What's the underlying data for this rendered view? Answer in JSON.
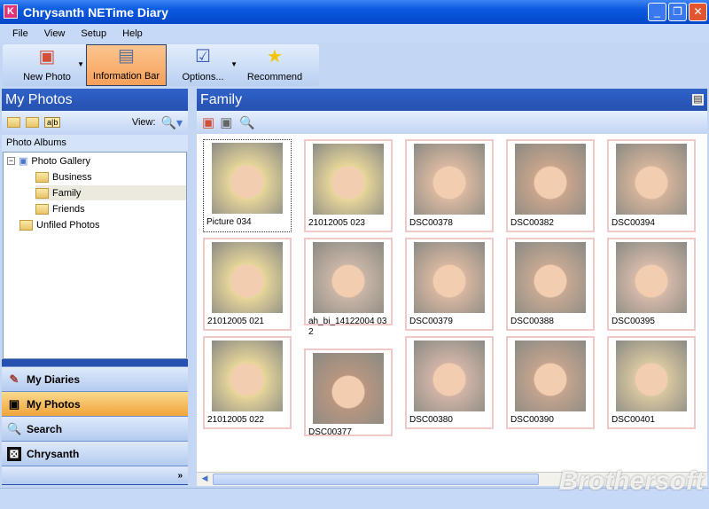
{
  "window": {
    "title": "Chrysanth NETime Diary"
  },
  "menu": [
    "File",
    "View",
    "Setup",
    "Help"
  ],
  "toolbar": {
    "new_photo": "New Photo",
    "information_bar": "Information Bar",
    "options": "Options...",
    "recommend": "Recommend"
  },
  "left": {
    "title": "My Photos",
    "view_label": "View:",
    "albums_label": "Photo Albums",
    "tree": {
      "root": "Photo Gallery",
      "children": [
        "Business",
        "Family",
        "Friends"
      ],
      "unfiled": "Unfiled Photos"
    },
    "nav": [
      "My Diaries",
      "My Photos",
      "Search",
      "Chrysanth"
    ]
  },
  "right": {
    "title": "Family",
    "photos": [
      "Picture 034",
      "21012005 023",
      "DSC00378",
      "DSC00382",
      "DSC00394",
      "21012005 021",
      "ah_bi_14122004 032",
      "DSC00379",
      "DSC00388",
      "DSC00395",
      "21012005 022",
      "DSC00377",
      "DSC00380",
      "DSC00390",
      "DSC00401"
    ]
  },
  "watermark": "Brothersoft"
}
